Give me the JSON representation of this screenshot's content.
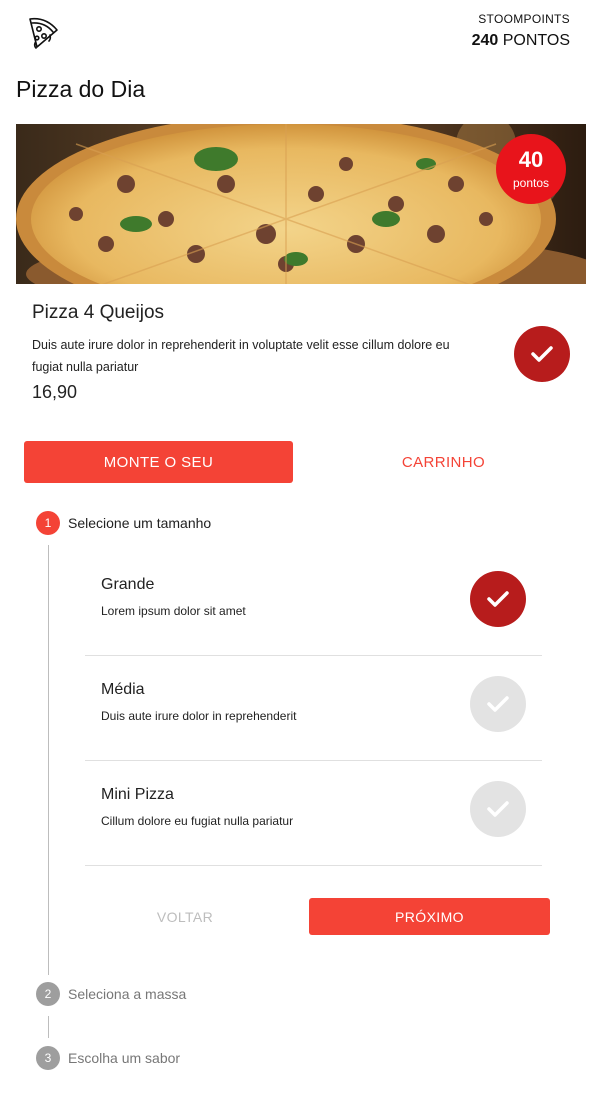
{
  "header": {
    "logo_icon": "pizza-slice-icon",
    "points_label": "STOOMPOINTS",
    "points_value": "240",
    "points_unit": "PONTOS"
  },
  "page_title": "Pizza do Dia",
  "hero": {
    "badge_value": "40",
    "badge_unit": "pontos"
  },
  "product": {
    "name": "Pizza 4 Queijos",
    "description": "Duis aute irure dolor in reprehenderit in voluptate velit esse cillum dolore eu fugiat nulla pariatur",
    "price": "16,90",
    "selected": true
  },
  "tabs": [
    {
      "label": "MONTE O SEU",
      "active": true
    },
    {
      "label": "CARRINHO",
      "active": false
    }
  ],
  "steps": [
    {
      "number": "1",
      "label": "Selecione um tamanho",
      "active": true
    },
    {
      "number": "2",
      "label": "Seleciona a massa",
      "active": false
    },
    {
      "number": "3",
      "label": "Escolha um sabor",
      "active": false
    }
  ],
  "sizes": [
    {
      "name": "Grande",
      "description": "Lorem ipsum dolor sit amet",
      "selected": true
    },
    {
      "name": "Média",
      "description": "Duis aute irure dolor in reprehenderit",
      "selected": false
    },
    {
      "name": "Mini Pizza",
      "description": "Cillum dolore eu fugiat nulla pariatur",
      "selected": false
    }
  ],
  "actions": {
    "back_label": "VOLTAR",
    "next_label": "PRÓXIMO"
  },
  "colors": {
    "accent": "#f44336",
    "badge": "#e8141b",
    "selected_check": "#b71c1c",
    "unselected_check": "#e3e3e3"
  }
}
